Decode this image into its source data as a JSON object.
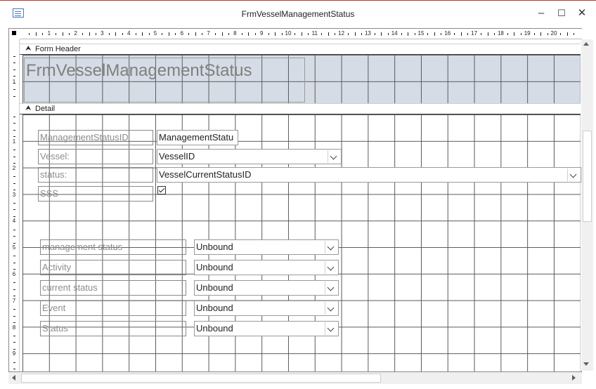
{
  "window": {
    "title": "FrmVesselManagementStatus",
    "minimize_glyph": "–",
    "maximize_glyph": "☐",
    "close_glyph": "✕"
  },
  "ruler": {
    "horizontal_numbers": [
      "1",
      "2",
      "3",
      "4",
      "5",
      "6",
      "7",
      "8",
      "9",
      "10",
      "11",
      "12",
      "13",
      "14",
      "15",
      "16",
      "17",
      "18",
      "19",
      "20",
      "2"
    ],
    "vertical_header_numbers": [
      "1"
    ],
    "vertical_detail_numbers": [
      "1",
      "2",
      "3",
      "4",
      "5",
      "6",
      "7",
      "8",
      "9"
    ]
  },
  "sections": {
    "header_label": "Form Header",
    "detail_label": "Detail"
  },
  "header": {
    "title_label": "FrmVesselManagementStatus"
  },
  "detail": {
    "fields": [
      {
        "label": "ManagementStatusID",
        "control": "ManagementStatu",
        "type": "textbox"
      },
      {
        "label": "Vessel:",
        "control": "VesselID",
        "type": "combo"
      },
      {
        "label": "status:",
        "control": "VesselCurrentStatusID",
        "type": "combo"
      },
      {
        "label": "SSS",
        "control": "",
        "type": "checkbox"
      }
    ],
    "unbound_fields": [
      {
        "label": "management status",
        "control": "Unbound"
      },
      {
        "label": "Activity",
        "control": "Unbound"
      },
      {
        "label": "current status",
        "control": "Unbound"
      },
      {
        "label": "Event",
        "control": "Unbound"
      },
      {
        "label": "Status",
        "control": "Unbound"
      }
    ]
  }
}
